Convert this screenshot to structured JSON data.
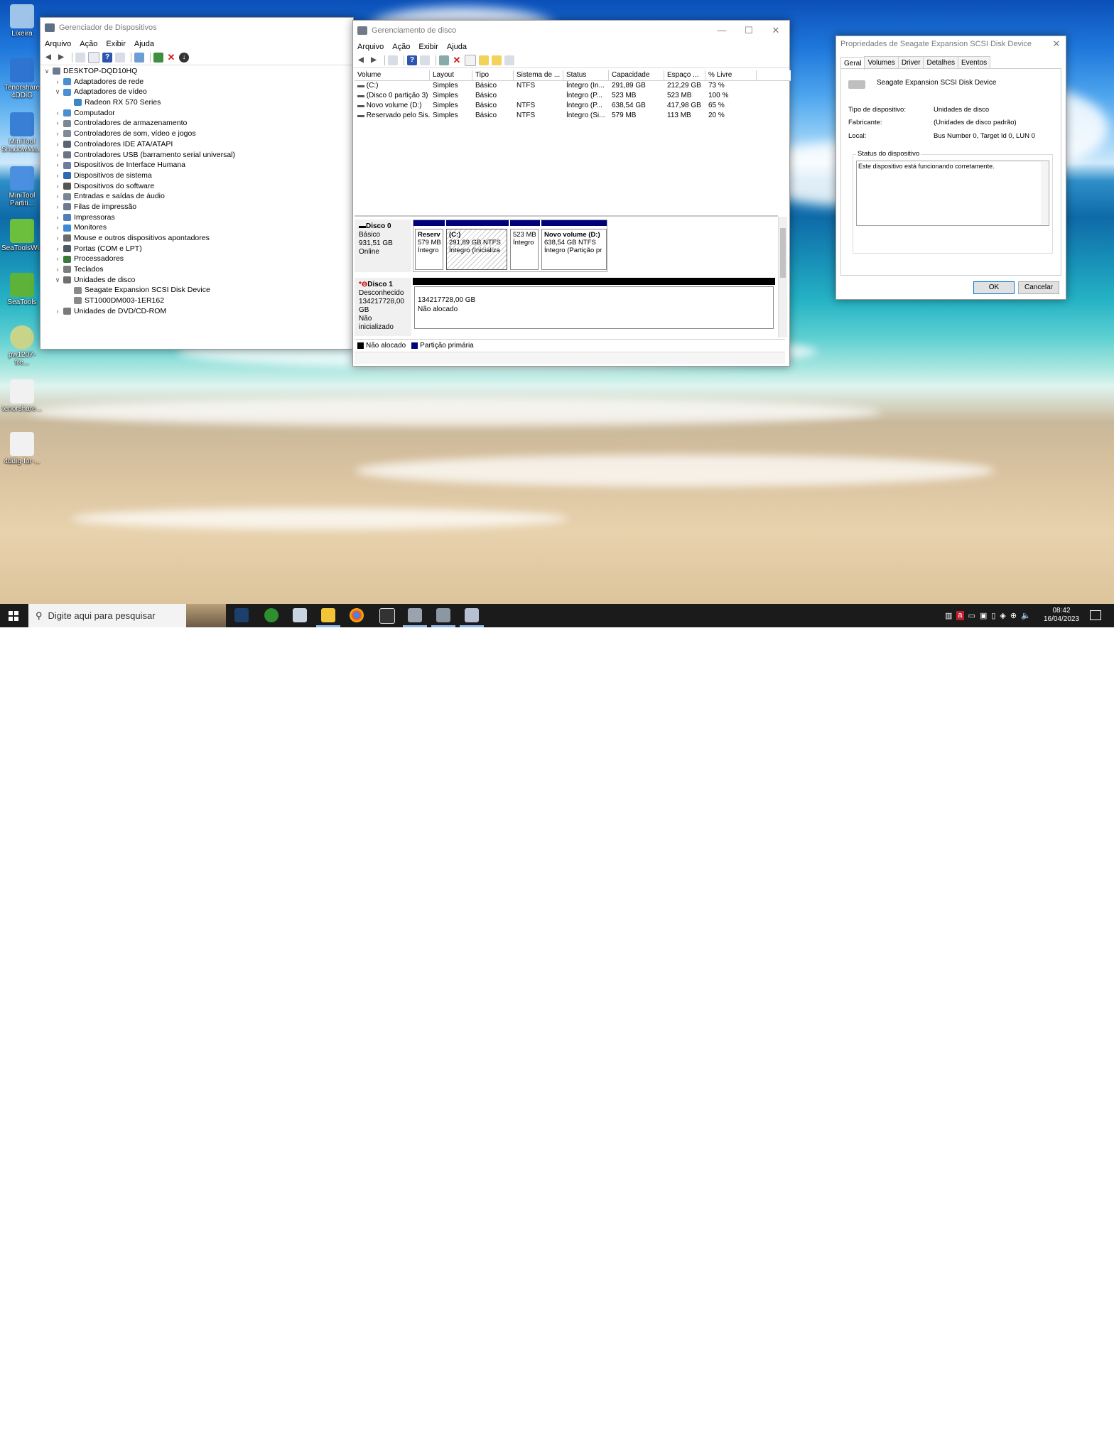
{
  "desktop": {
    "icons": [
      {
        "label": "Lixeira"
      },
      {
        "label": "Tenorshare 4DDiG"
      },
      {
        "label": "MiniTool ShadowMa..."
      },
      {
        "label": "MiniTool Partiti..."
      },
      {
        "label": "SeaToolsWi..."
      },
      {
        "label": "SeaTools"
      },
      {
        "label": "pw1207-fre..."
      },
      {
        "label": "tenorshare..."
      },
      {
        "label": "4ddig-for-..."
      }
    ]
  },
  "device_manager": {
    "title": "Gerenciador de Dispositivos",
    "menu": [
      "Arquivo",
      "Ação",
      "Exibir",
      "Ajuda"
    ],
    "tree": [
      {
        "label": "DESKTOP-DQD10HQ",
        "chev": "∨",
        "indent": 0
      },
      {
        "label": "Adaptadores de rede",
        "chev": "›",
        "indent": 1
      },
      {
        "label": "Adaptadores de vídeo",
        "chev": "∨",
        "indent": 1
      },
      {
        "label": "Radeon RX 570 Series",
        "chev": "",
        "indent": 2
      },
      {
        "label": "Computador",
        "chev": "›",
        "indent": 1
      },
      {
        "label": "Controladores de armazenamento",
        "chev": "›",
        "indent": 1
      },
      {
        "label": "Controladores de som, vídeo e jogos",
        "chev": "›",
        "indent": 1
      },
      {
        "label": "Controladores IDE ATA/ATAPI",
        "chev": "›",
        "indent": 1
      },
      {
        "label": "Controladores USB (barramento serial universal)",
        "chev": "›",
        "indent": 1
      },
      {
        "label": "Dispositivos de Interface Humana",
        "chev": "›",
        "indent": 1
      },
      {
        "label": "Dispositivos de sistema",
        "chev": "›",
        "indent": 1
      },
      {
        "label": "Dispositivos do software",
        "chev": "›",
        "indent": 1
      },
      {
        "label": "Entradas e saídas de áudio",
        "chev": "›",
        "indent": 1
      },
      {
        "label": "Filas de impressão",
        "chev": "›",
        "indent": 1
      },
      {
        "label": "Impressoras",
        "chev": "›",
        "indent": 1
      },
      {
        "label": "Monitores",
        "chev": "›",
        "indent": 1
      },
      {
        "label": "Mouse e outros dispositivos apontadores",
        "chev": "›",
        "indent": 1
      },
      {
        "label": "Portas (COM e LPT)",
        "chev": "›",
        "indent": 1
      },
      {
        "label": "Processadores",
        "chev": "›",
        "indent": 1
      },
      {
        "label": "Teclados",
        "chev": "›",
        "indent": 1
      },
      {
        "label": "Unidades de disco",
        "chev": "∨",
        "indent": 1
      },
      {
        "label": "Seagate Expansion SCSI Disk Device",
        "chev": "",
        "indent": 2
      },
      {
        "label": "ST1000DM003-1ER162",
        "chev": "",
        "indent": 2
      },
      {
        "label": "Unidades de DVD/CD-ROM",
        "chev": "›",
        "indent": 1
      }
    ]
  },
  "disk_management": {
    "title": "Gerenciamento de disco",
    "menu": [
      "Arquivo",
      "Ação",
      "Exibir",
      "Ajuda"
    ],
    "columns": [
      "Volume",
      "Layout",
      "Tipo",
      "Sistema de ...",
      "Status",
      "Capacidade",
      "Espaço ...",
      "% Livre"
    ],
    "rows": [
      [
        "(C:)",
        "Simples",
        "Básico",
        "NTFS",
        "Íntegro (In...",
        "291,89 GB",
        "212,29 GB",
        "73 %"
      ],
      [
        "(Disco 0 partição 3)",
        "Simples",
        "Básico",
        "",
        "Íntegro (P...",
        "523 MB",
        "523 MB",
        "100 %"
      ],
      [
        "Novo volume (D:)",
        "Simples",
        "Básico",
        "NTFS",
        "Íntegro (P...",
        "638,54 GB",
        "417,98 GB",
        "65 %"
      ],
      [
        "Reservado pelo Sis...",
        "Simples",
        "Básico",
        "NTFS",
        "Íntegro (Si...",
        "579 MB",
        "113 MB",
        "20 %"
      ]
    ],
    "disk0": {
      "name": "Disco 0",
      "type": "Básico",
      "size": "931,51 GB",
      "state": "Online",
      "partitions": [
        {
          "l1": "Reserv",
          "l2": "579 MB",
          "l3": "Íntegro"
        },
        {
          "l1": "(C:)",
          "l2": "291,89 GB NTFS",
          "l3": "Íntegro (Inicializa"
        },
        {
          "l1": "",
          "l2": "523 MB",
          "l3": "Íntegro"
        },
        {
          "l1": "Novo volume  (D:)",
          "l2": "638,54 GB NTFS",
          "l3": "Íntegro (Partição pr"
        }
      ]
    },
    "disk1": {
      "name": "Disco 1",
      "type": "Desconhecido",
      "size": "134217728,00 GB",
      "state": "Não inicializado",
      "area_size": "134217728,00 GB",
      "area_state": "Não alocado"
    },
    "legend": {
      "unallocated": "Não alocado",
      "primary": "Partição primária"
    }
  },
  "properties": {
    "title": "Propriedades de Seagate Expansion SCSI Disk Device",
    "tabs": [
      "Geral",
      "Volumes",
      "Driver",
      "Detalhes",
      "Eventos"
    ],
    "device_name": "Seagate Expansion SCSI Disk Device",
    "fields": [
      {
        "label": "Tipo de dispositivo:",
        "value": "Unidades de disco"
      },
      {
        "label": "Fabricante:",
        "value": "(Unidades de disco padrão)"
      },
      {
        "label": "Local:",
        "value": "Bus Number 0, Target Id 0, LUN 0"
      }
    ],
    "status_group": "Status do dispositivo",
    "status_text": "Este dispositivo está funcionando corretamente.",
    "ok": "OK",
    "cancel": "Cancelar"
  },
  "taskbar": {
    "search_placeholder": "Digite aqui para pesquisar",
    "time": "08:42",
    "date": "16/04/2023"
  }
}
